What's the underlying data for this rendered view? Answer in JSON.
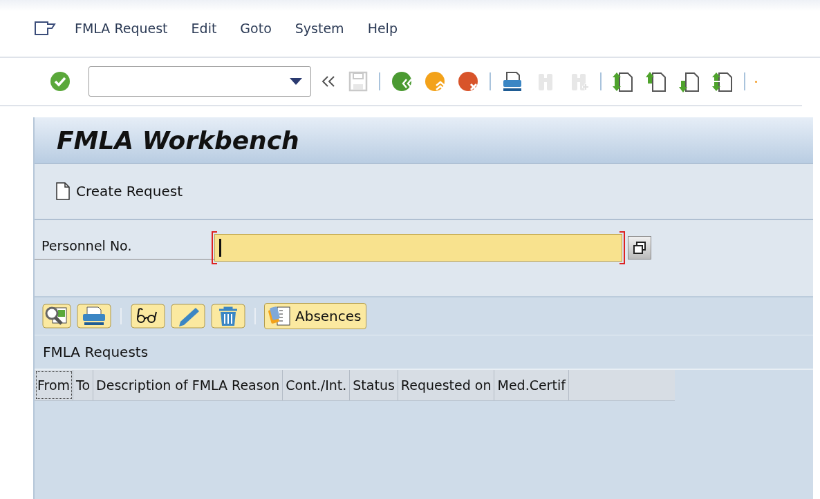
{
  "menu": [
    {
      "label": "FMLA Request"
    },
    {
      "label": "Edit"
    },
    {
      "label": "Goto"
    },
    {
      "label": "System"
    },
    {
      "label": "Help"
    }
  ],
  "toolbar": [
    {
      "kind": "enter",
      "disabled": false
    },
    {
      "kind": "command-field"
    },
    {
      "kind": "collapse"
    },
    {
      "kind": "save",
      "disabled": true
    },
    {
      "kind": "separator"
    },
    {
      "kind": "back",
      "disabled": false
    },
    {
      "kind": "exit",
      "disabled": false
    },
    {
      "kind": "cancel",
      "disabled": false
    },
    {
      "kind": "separator"
    },
    {
      "kind": "print",
      "disabled": false
    },
    {
      "kind": "find",
      "disabled": true
    },
    {
      "kind": "find-next",
      "disabled": true
    },
    {
      "kind": "separator"
    },
    {
      "kind": "first-page",
      "disabled": false
    },
    {
      "kind": "previous-page",
      "disabled": false
    },
    {
      "kind": "next-page",
      "disabled": false
    },
    {
      "kind": "last-page",
      "disabled": false
    },
    {
      "kind": "separator"
    }
  ],
  "title": "FMLA Workbench",
  "create_button": "Create Request",
  "field": {
    "label": "Personnel No.",
    "required": true
  },
  "alv_toolbar": [
    {
      "kind": "details"
    },
    {
      "kind": "print"
    },
    {
      "kind": "separator"
    },
    {
      "kind": "display"
    },
    {
      "kind": "edit"
    },
    {
      "kind": "delete"
    },
    {
      "kind": "separator"
    },
    {
      "kind": "absences",
      "label": "Absences"
    }
  ],
  "table": {
    "title": "FMLA Requests",
    "columns": [
      {
        "label": "From",
        "focused": true
      },
      {
        "label": "To",
        "focused": false
      },
      {
        "label": "Description of FMLA Reason",
        "focused": false
      },
      {
        "label": "Cont./Int.",
        "focused": false
      },
      {
        "label": "Status",
        "focused": false
      },
      {
        "label": "Requested on",
        "focused": false
      },
      {
        "label": "Med.Certif",
        "focused": false
      }
    ]
  }
}
